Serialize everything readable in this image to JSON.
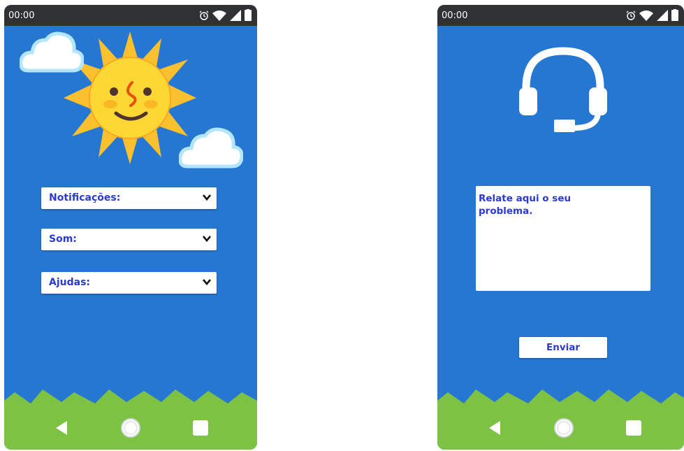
{
  "colors": {
    "sky": "#2677d2",
    "grass": "#7dc242",
    "statusbar": "#2f3134",
    "text_accent": "#2b3bd0"
  },
  "settings_screen": {
    "status_time": "00:00",
    "status_icons": [
      "alarm-icon",
      "wifi-icon",
      "signal-icon",
      "battery-icon"
    ],
    "illustration": [
      "sun-face-icon",
      "cloud-icon",
      "cloud-icon"
    ],
    "dropdowns": [
      {
        "label": "Notificações:"
      },
      {
        "label": "Som:"
      },
      {
        "label": "Ajudas:"
      }
    ],
    "nav": [
      "back-icon",
      "home-icon",
      "recents-icon"
    ]
  },
  "support_screen": {
    "status_time": "00:00",
    "status_icons": [
      "alarm-icon",
      "wifi-icon",
      "signal-icon",
      "battery-icon"
    ],
    "header_icon": "headset-icon",
    "message_placeholder": "Relate aqui o seu\nproblema.",
    "send_label": "Enviar",
    "nav": [
      "back-icon",
      "home-icon",
      "recents-icon"
    ]
  }
}
